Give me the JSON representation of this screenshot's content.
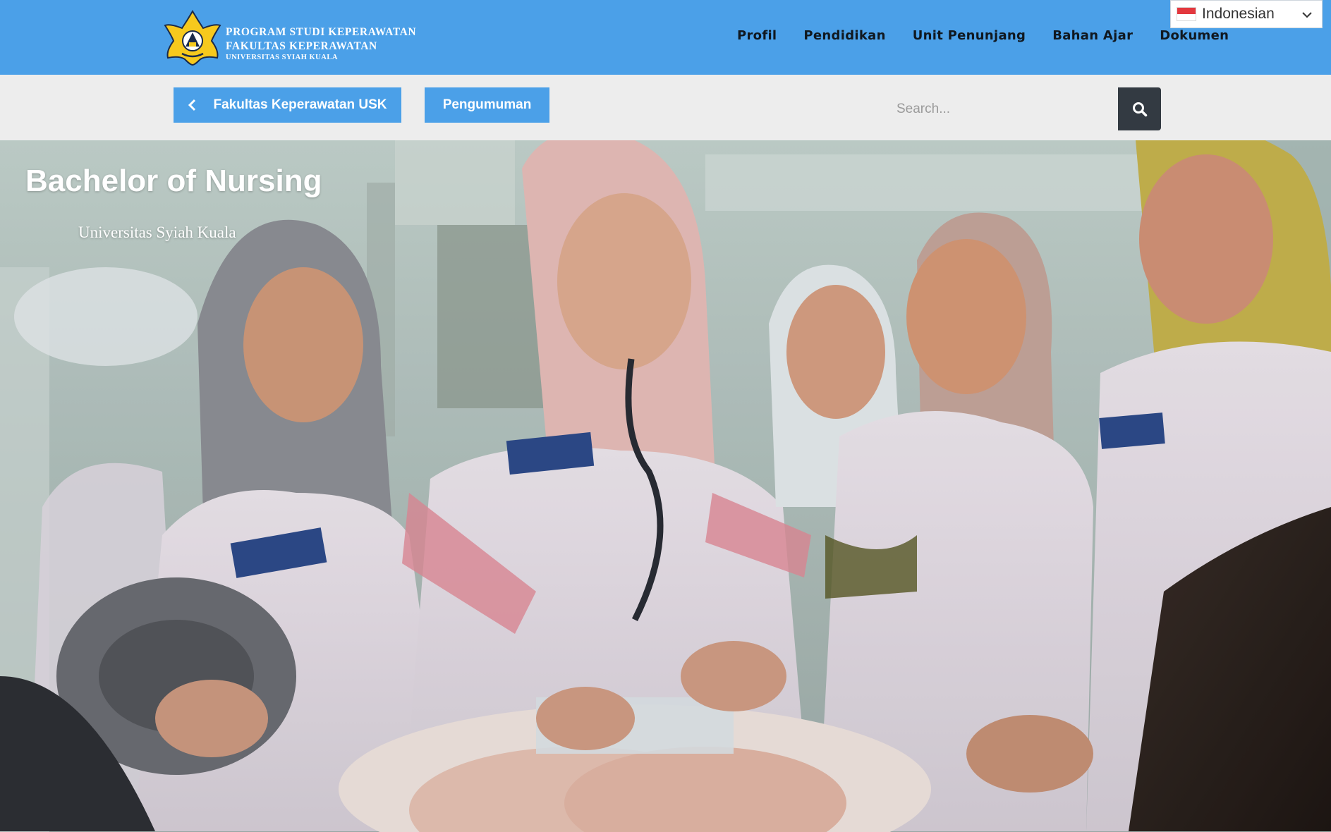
{
  "header": {
    "brand_line1": "PROGRAM STUDI KEPERAWATAN",
    "brand_line2": "FAKULTAS KEPERAWATAN",
    "brand_line3": "UNIVERSITAS SYIAH KUALA",
    "accent_color": "#4ba0e8",
    "nav": [
      {
        "label": "Profil"
      },
      {
        "label": "Pendidikan"
      },
      {
        "label": "Unit Penunjang"
      },
      {
        "label": "Bahan Ajar"
      },
      {
        "label": "Dokumen"
      }
    ],
    "language": {
      "selected": "Indonesian",
      "flag_icon": "indonesia-flag-icon"
    }
  },
  "subbar": {
    "back_button_label": "Fakultas Keperawatan USK",
    "announcement_button_label": "Pengumuman",
    "search_placeholder": "Search...",
    "search_icon": "search-icon"
  },
  "hero": {
    "title": "Bachelor of Nursing",
    "subtitle": "Universitas Syiah Kuala",
    "image_subject": "nursing students in white coats and hijabs practicing with a stethoscope on an infant manikin"
  }
}
